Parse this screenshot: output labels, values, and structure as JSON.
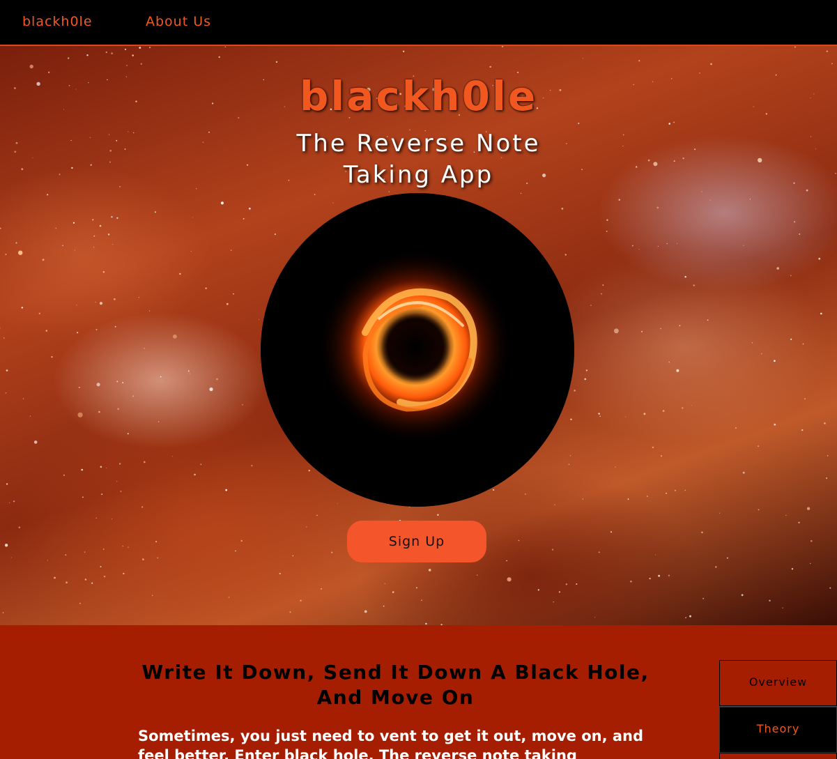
{
  "nav": {
    "brand": "blackh0le",
    "about": "About Us"
  },
  "hero": {
    "title": "blackh0le",
    "subtitle_line1": "The Reverse Note",
    "subtitle_line2": "Taking App",
    "signup_label": "Sign Up"
  },
  "content": {
    "title": "Write It Down, Send It Down A Black Hole, And Move On",
    "body": "Sometimes, you just need to vent to get it out, move on, and feel better. Enter black hole. The reverse note taking"
  },
  "side_tabs": [
    {
      "label": "Overview"
    },
    {
      "label": "Theory"
    }
  ],
  "colors": {
    "accent": "#f0581f",
    "section_bg": "#a51e02",
    "button": "#f5552a",
    "nav_bg": "#000000"
  },
  "icons": {
    "black_hole_image": "black-hole-image"
  }
}
